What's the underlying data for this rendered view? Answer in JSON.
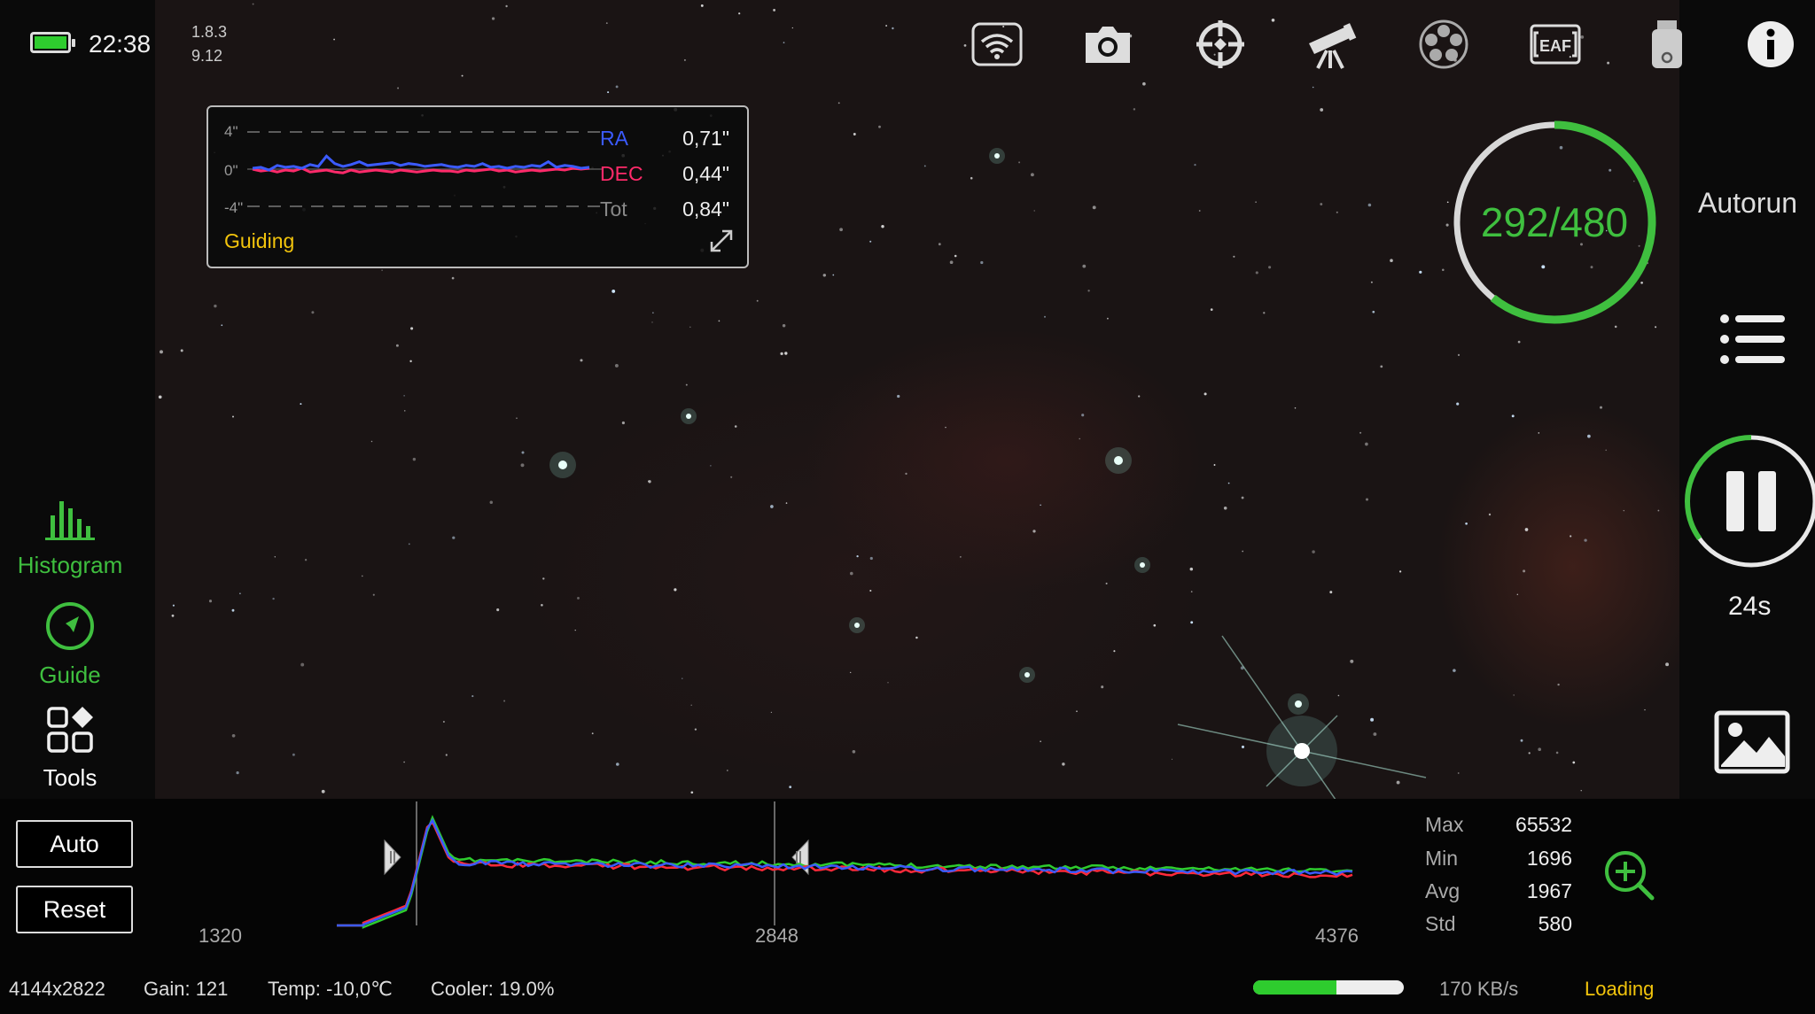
{
  "status": {
    "time": "22:38",
    "version_app": "1.8.3",
    "version_fw": "9.12",
    "battery_color": "#2ecc2e"
  },
  "toolbar": {
    "icons": [
      "wifi-icon",
      "camera-icon",
      "crosshair-icon",
      "telescope-icon",
      "filter-wheel-icon",
      "eaf-icon",
      "usb-drive-icon",
      "info-icon"
    ],
    "eaf_label": "EAF"
  },
  "guide_graph": {
    "y_top": "4\"",
    "y_mid": "0\"",
    "y_bottom": "-4\"",
    "ra_label": "RA",
    "ra_value": "0,71\"",
    "dec_label": "DEC",
    "dec_value": "0,44\"",
    "tot_label": "Tot",
    "tot_value": "0,84\"",
    "state": "Guiding",
    "ra_color": "#3b5bff",
    "dec_color": "#ff2a6a",
    "ra_series": [
      0.1,
      0.2,
      -0.1,
      0.4,
      0.2,
      0.3,
      0.1,
      0.5,
      0.3,
      1.4,
      0.6,
      0.3,
      0.5,
      0.8,
      0.4,
      0.5,
      0.6,
      0.7,
      0.4,
      0.6,
      0.5,
      0.3,
      0.4,
      0.5,
      0.3,
      0.2,
      0.4,
      0.3,
      0.6,
      0.2,
      0.3,
      0.1,
      0.3,
      0.2,
      0.4,
      0.3,
      0.8,
      0.2,
      0.4,
      0.3,
      0.1,
      0.2
    ],
    "dec_series": [
      0.0,
      -0.2,
      -0.1,
      -0.3,
      -0.1,
      -0.2,
      0.1,
      -0.3,
      -0.2,
      -0.1,
      -0.3,
      -0.4,
      -0.1,
      -0.3,
      -0.2,
      -0.1,
      -0.2,
      -0.3,
      -0.1,
      -0.2,
      -0.3,
      -0.2,
      -0.1,
      -0.2,
      -0.2,
      -0.3,
      -0.1,
      -0.2,
      -0.1,
      0.0,
      -0.2,
      -0.1,
      -0.3,
      -0.2,
      -0.1,
      -0.2,
      -0.1,
      0.0,
      -0.1,
      0.1,
      0.0,
      0.1
    ]
  },
  "progress": {
    "label": "292/480",
    "done": 292,
    "total": 480,
    "color": "#3fbf3f"
  },
  "right_panel": {
    "autorun_label": "Autorun",
    "countdown": "24s",
    "countdown_fraction": 0.35
  },
  "left_nav": [
    {
      "label": "Histogram",
      "icon": "histogram-icon"
    },
    {
      "label": "Guide",
      "icon": "compass-icon"
    },
    {
      "label": "Tools",
      "icon": "tools-grid-icon"
    }
  ],
  "histogram": {
    "auto_label": "Auto",
    "reset_label": "Reset",
    "ticks": [
      "1320",
      "2848",
      "4376"
    ],
    "stats": [
      {
        "label": "Max",
        "value": "65532"
      },
      {
        "label": "Min",
        "value": "1696"
      },
      {
        "label": "Avg",
        "value": "1967"
      },
      {
        "label": "Std",
        "value": "580"
      }
    ]
  },
  "footer": {
    "resolution": "4144x2822",
    "gain": "Gain: 121",
    "temp": "Temp: -10,0℃",
    "cooler": "Cooler: 19.0%",
    "speed": "170 KB/s",
    "load_state": "Loading",
    "load_fraction": 0.55
  }
}
